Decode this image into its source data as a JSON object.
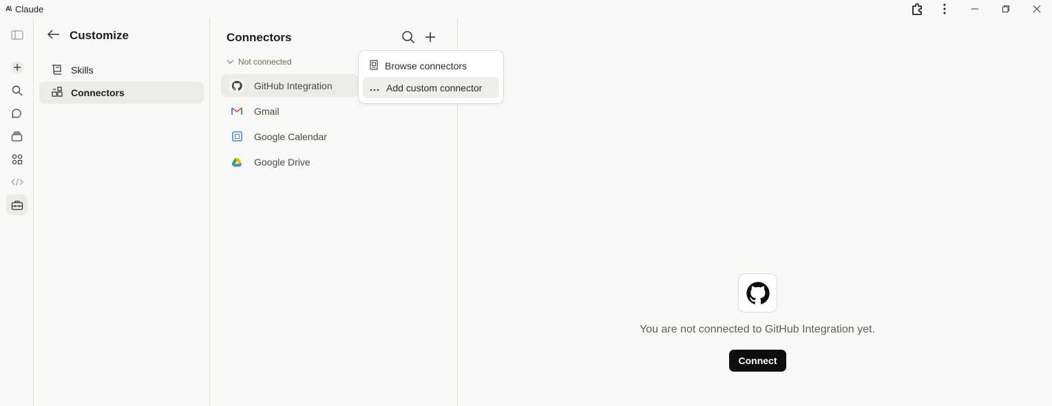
{
  "window": {
    "app_name": "Claude",
    "app_logo": "A\\"
  },
  "rail": {
    "icons": [
      "sidebar-toggle-icon",
      "new-chat-icon",
      "search-icon",
      "chats-icon",
      "projects-icon",
      "artifacts-icon",
      "code-icon",
      "customize-icon"
    ]
  },
  "customize": {
    "title": "Customize",
    "nav": [
      {
        "label": "Skills",
        "icon": "skills-icon"
      },
      {
        "label": "Connectors",
        "icon": "connectors-icon"
      }
    ]
  },
  "connectors": {
    "title": "Connectors",
    "section_label": "Not connected",
    "items": [
      {
        "label": "GitHub Integration",
        "icon": "github-icon"
      },
      {
        "label": "Gmail",
        "icon": "gmail-icon"
      },
      {
        "label": "Google Calendar",
        "icon": "google-calendar-icon"
      },
      {
        "label": "Google Drive",
        "icon": "google-drive-icon"
      }
    ]
  },
  "add_menu": {
    "items": [
      {
        "label": "Browse connectors",
        "icon": "browse-icon"
      },
      {
        "label": "Add custom connector",
        "icon": "more-dots-icon"
      }
    ]
  },
  "detail": {
    "message": "You are not connected to GitHub Integration yet.",
    "connect_label": "Connect"
  },
  "colors": {
    "background": "#f8f8f6",
    "selected": "#ecebe6",
    "primary_button": "#0f0f0f"
  }
}
